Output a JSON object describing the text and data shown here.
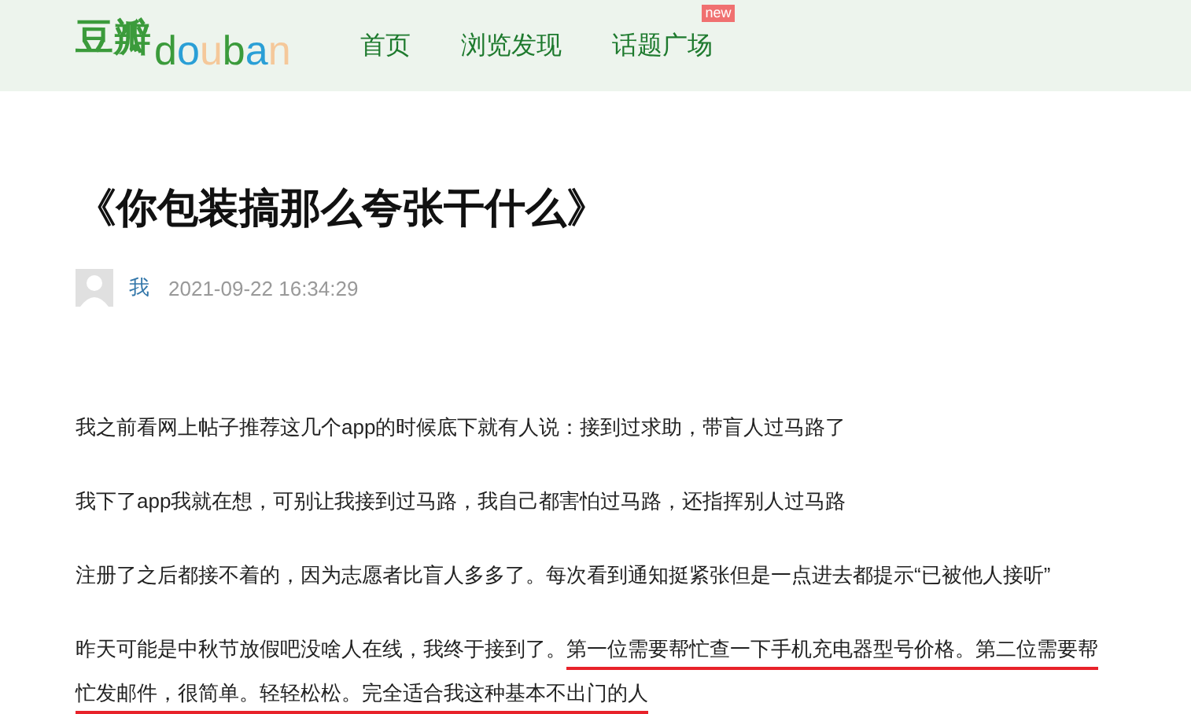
{
  "header": {
    "logo_cn": "豆瓣",
    "logo_en": "douban",
    "nav": [
      {
        "label": "首页"
      },
      {
        "label": "浏览发现"
      },
      {
        "label": "话题广场",
        "badge": "new"
      }
    ]
  },
  "article": {
    "title": "《你包装搞那么夸张干什么》",
    "author": "我",
    "time": "2021-09-22 16:34:29",
    "paragraphs": [
      [
        {
          "text": "我之前看网上帖子推荐这几个app的时候底下就有人说：接到过求助，带盲人过马路了",
          "underlined": false
        }
      ],
      [
        {
          "text": "我下了app我就在想，可别让我接到过马路，我自己都害怕过马路，还指挥别人过马路",
          "underlined": false
        }
      ],
      [
        {
          "text": "注册了之后都接不着的，因为志愿者比盲人多多了。每次看到通知挺紧张但是一点进去都提示“已被他人接听”",
          "underlined": false
        }
      ],
      [
        {
          "text": "昨天可能是中秋节放假吧没啥人在线，我终于接到了。",
          "underlined": false
        },
        {
          "text": "第一位需要帮忙查一下手机充电器型号价格。第二位需要帮忙发邮件，很简单。轻轻松松。完全适合我这种基本不出门的人",
          "underlined": true
        }
      ]
    ]
  }
}
